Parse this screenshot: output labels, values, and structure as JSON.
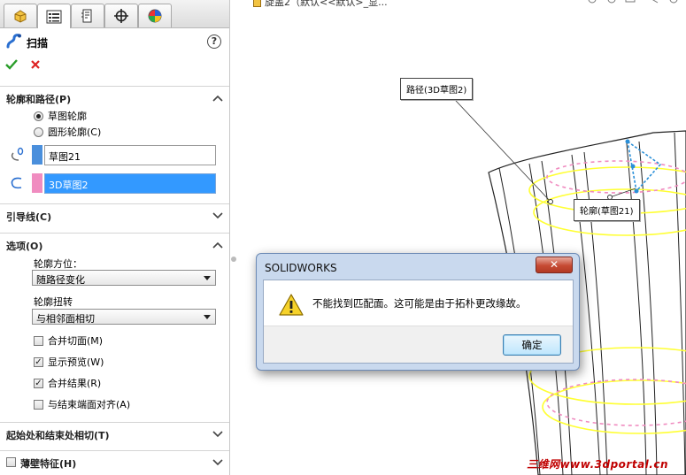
{
  "panel": {
    "tabs": [
      "featuremanager-tab",
      "propertymanager-tab",
      "configurationmanager-tab",
      "dimxpert-tab",
      "display-manager-tab"
    ],
    "feature_title": "扫描",
    "help_label": "?",
    "profile_path": {
      "header": "轮廓和路径(P)",
      "radio_sketch_profile": "草图轮廓",
      "radio_circular_profile": "圆形轮廓(C)",
      "profile_value": "草图21",
      "path_value": "3D草图2",
      "profile_color": "#4a8fdc",
      "path_color": "#f08cc0"
    },
    "guide_curves": {
      "header": "引导线(C)"
    },
    "options": {
      "header": "选项(O)",
      "orientation_label": "轮廓方位：",
      "orientation_value": "随路径变化",
      "twist_label": "轮廓扭转",
      "twist_value": "与相邻面相切",
      "merge_tangent": "合并切面(M)",
      "show_preview": "显示预览(W)",
      "merge_result": "合并结果(R)",
      "align_end_faces": "与结束端面对齐(A)"
    },
    "tangency": {
      "header": "起始处和结束处相切(T)"
    },
    "thin_feature": {
      "header": "薄壁特征(H)"
    }
  },
  "viewport": {
    "crumb": "旋盖2（默认<<默认>_显...",
    "callout_path": "路径(3D草图2)",
    "callout_profile": "轮廓(草图21)",
    "watermark": "三维网www.3dportal.cn"
  },
  "dialog": {
    "title": "SOLIDWORKS",
    "message": "不能找到匹配面。这可能是由于拓朴更改缘故。",
    "ok_label": "确定",
    "close_label": "✕"
  },
  "colors": {
    "accent_yellow": "#ffff33",
    "accent_pink": "#f08cc0",
    "selection_blue": "#3399ff"
  }
}
